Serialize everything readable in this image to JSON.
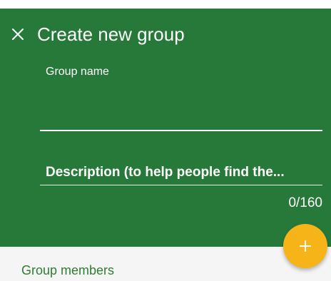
{
  "header": {
    "close_icon": "close-icon",
    "title": "Create new group"
  },
  "form": {
    "group_name_label": "Group name",
    "group_name_value": "",
    "description_placeholder": "Description (to help people find the...",
    "char_counter": "0/160"
  },
  "members": {
    "title": "Group members"
  },
  "fab": {
    "icon": "plus-icon",
    "label": "+"
  },
  "colors": {
    "header_bg": "#27793a",
    "fab_bg": "#f7b419",
    "section_bg": "#f5f5f5",
    "section_title": "#2e7d32"
  }
}
